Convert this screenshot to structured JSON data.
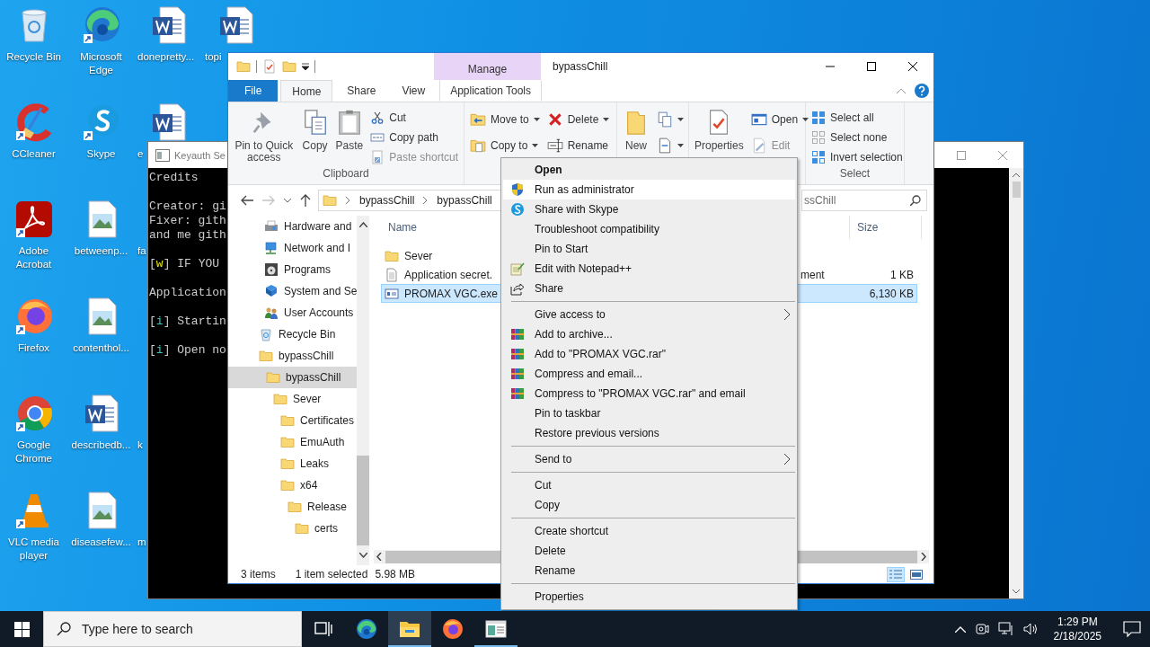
{
  "desktop": {
    "columns": [
      [
        {
          "kind": "bin",
          "label": "Recycle Bin"
        },
        {
          "kind": "cleaner",
          "label": "CCleaner"
        },
        {
          "kind": "acrobat",
          "label": "Adobe Acrobat"
        },
        {
          "kind": "firefox",
          "label": "Firefox"
        },
        {
          "kind": "chrome",
          "label": "Google Chrome"
        },
        {
          "kind": "vlc",
          "label": "VLC media player"
        }
      ],
      [
        {
          "kind": "edge",
          "label": "Microsoft Edge"
        },
        {
          "kind": "skype",
          "label": "Skype"
        },
        {
          "kind": "image",
          "label": "betweenp..."
        },
        {
          "kind": "image",
          "label": "contenthol..."
        },
        {
          "kind": "word",
          "label": "describedb..."
        },
        {
          "kind": "image",
          "label": "diseasefew..."
        }
      ],
      [
        {
          "kind": "word",
          "label": "donepretty..."
        },
        {
          "kind": "word",
          "label": "e"
        },
        {
          "kind": "hidden",
          "label": "fa"
        },
        {
          "kind": "hidden"
        },
        {
          "kind": "hidden",
          "label": "k"
        },
        {
          "kind": "hidden",
          "label": "m"
        }
      ],
      [
        {
          "kind": "word",
          "label": "topi"
        }
      ]
    ]
  },
  "console": {
    "title": "Keyauth Se",
    "paragraphs": [
      [
        [
          {
            "kind": "plain",
            "text": "Credits"
          }
        ]
      ],
      [
        [
          {
            "kind": "plain",
            "text": "Creator: gi"
          }
        ],
        [
          {
            "kind": "plain",
            "text": "Fixer: gith"
          }
        ],
        [
          {
            "kind": "plain",
            "text": "and me gith"
          }
        ]
      ],
      [
        [
          {
            "kind": "plain",
            "text": "["
          },
          {
            "kind": "warn",
            "text": "w"
          },
          {
            "kind": "plain",
            "text": "] IF YOU"
          }
        ]
      ],
      [
        [
          {
            "kind": "plain",
            "text": "Application"
          }
        ]
      ],
      [
        [
          {
            "kind": "plain",
            "text": "["
          },
          {
            "kind": "info",
            "text": "i"
          },
          {
            "kind": "plain",
            "text": "] Startin"
          }
        ]
      ],
      [
        [
          {
            "kind": "plain",
            "text": "["
          },
          {
            "kind": "info",
            "text": "i"
          },
          {
            "kind": "plain",
            "text": "] Open no"
          }
        ]
      ]
    ]
  },
  "explorer": {
    "title": "bypassChill",
    "context_tab": "Manage",
    "tabs": [
      {
        "kind": "file",
        "label": "File",
        "selected": false
      },
      {
        "kind": "tab",
        "label": "Home",
        "selected": true
      },
      {
        "kind": "tab",
        "label": "Share",
        "selected": false
      },
      {
        "kind": "tab",
        "label": "View",
        "selected": false
      },
      {
        "kind": "context",
        "label": "Application Tools",
        "selected": false
      }
    ],
    "ribbon": [
      {
        "label": "Clipboard",
        "columns": [
          {
            "kind": "large",
            "buttons": [
              {
                "label": "Pin to Quick access",
                "disabled": false
              }
            ]
          },
          {
            "kind": "large",
            "buttons": [
              {
                "label": "Copy",
                "disabled": false
              }
            ]
          },
          {
            "kind": "large",
            "buttons": [
              {
                "label": "Paste",
                "disabled": false
              }
            ]
          },
          {
            "kind": "stack",
            "buttons": [
              {
                "label": "Cut",
                "disabled": false
              },
              {
                "label": "Copy path",
                "disabled": false
              },
              {
                "label": "Paste shortcut",
                "disabled": true
              }
            ]
          }
        ]
      },
      {
        "columns": [
          {
            "kind": "pair",
            "buttons": [
              {
                "label": "Move to",
                "dropdown": true,
                "disabled": false
              },
              {
                "label": "Copy to",
                "dropdown": true,
                "disabled": false
              }
            ]
          },
          {
            "kind": "pair",
            "buttons": [
              {
                "label": "Delete",
                "dropdown": true,
                "disabled": false
              },
              {
                "label": "Rename",
                "dropdown": false,
                "disabled": false
              }
            ]
          }
        ]
      },
      {
        "columns": [
          {
            "kind": "large",
            "buttons": [
              {
                "label": "New",
                "disabled": false
              }
            ]
          },
          {
            "kind": "pair",
            "buttons": [
              {
                "dropdown": true
              },
              {
                "dropdown": true
              }
            ]
          }
        ]
      },
      {
        "columns": [
          {
            "kind": "large",
            "buttons": [
              {
                "label": "Properties",
                "disabled": false
              }
            ]
          },
          {
            "kind": "pair",
            "buttons": [
              {
                "label": "Open",
                "dropdown": true,
                "disabled": false
              },
              {
                "label": "Edit",
                "dropdown": false,
                "disabled": true
              }
            ]
          }
        ]
      },
      {
        "label": "Select",
        "columns": [
          {
            "kind": "stack",
            "buttons": [
              {
                "label": "Select all",
                "disabled": false
              },
              {
                "label": "Select none",
                "disabled": false
              },
              {
                "label": "Invert selection",
                "disabled": false
              }
            ]
          }
        ]
      }
    ],
    "address": {
      "crumbs": [
        "bypassChill",
        "bypassChill"
      ]
    },
    "search": {
      "placeholder": "ssChill"
    },
    "nav": [
      {
        "kind": "hardware",
        "label": "Hardware and",
        "selected": false
      },
      {
        "kind": "network",
        "label": "Network and I",
        "selected": false
      },
      {
        "kind": "programs",
        "label": "Programs",
        "selected": false
      },
      {
        "kind": "system",
        "label": "System and Se",
        "selected": false
      },
      {
        "kind": "users",
        "label": "User Accounts",
        "selected": false
      },
      {
        "kind": "bin",
        "label": "Recycle Bin",
        "selected": false
      },
      {
        "kind": "folder",
        "label": "bypassChill",
        "selected": false,
        "children": [
          {
            "kind": "folder",
            "label": "bypassChill",
            "selected": true,
            "children": [
              {
                "kind": "folder",
                "label": "Sever",
                "selected": false,
                "children": [
                  {
                    "kind": "folder",
                    "label": "Certificates",
                    "selected": false
                  },
                  {
                    "kind": "folder",
                    "label": "EmuAuth",
                    "selected": false
                  },
                  {
                    "kind": "folder",
                    "label": "Leaks",
                    "selected": false
                  },
                  {
                    "kind": "folder",
                    "label": "x64",
                    "selected": false,
                    "children": [
                      {
                        "kind": "folder",
                        "label": "Release",
                        "selected": false,
                        "children": [
                          {
                            "kind": "folder",
                            "label": "certs",
                            "selected": false
                          }
                        ]
                      }
                    ]
                  }
                ]
              }
            ]
          }
        ]
      }
    ],
    "columns": [
      "Name",
      "Size"
    ],
    "files": [
      {
        "kind": "folder",
        "name": "Sever",
        "selected": false
      },
      {
        "kind": "text",
        "name": "Application secret.",
        "type": "ment",
        "size": "1 KB",
        "selected": false
      },
      {
        "kind": "exe",
        "name": "PROMAX VGC.exe",
        "size": "6,130 KB",
        "selected": true
      }
    ],
    "status": {
      "count": "3 items",
      "selection": "1 item selected",
      "size": "5.98 MB"
    }
  },
  "context_menu": [
    {
      "kind": "default",
      "label": "Open",
      "highlighted": false
    },
    {
      "kind": "item",
      "label": "Run as administrator",
      "highlighted": true
    },
    {
      "kind": "item",
      "label": "Share with Skype",
      "highlighted": false
    },
    {
      "kind": "item",
      "label": "Troubleshoot compatibility",
      "highlighted": false
    },
    {
      "kind": "item",
      "label": "Pin to Start",
      "highlighted": false
    },
    {
      "kind": "item",
      "label": "Edit with Notepad++",
      "highlighted": false
    },
    {
      "kind": "item",
      "label": "Share",
      "highlighted": false
    },
    {
      "kind": "separator"
    },
    {
      "kind": "submenu",
      "label": "Give access to",
      "highlighted": false
    },
    {
      "kind": "item",
      "label": "Add to archive...",
      "highlighted": false
    },
    {
      "kind": "item",
      "label": "Add to \"PROMAX VGC.rar\"",
      "highlighted": false
    },
    {
      "kind": "item",
      "label": "Compress and email...",
      "highlighted": false
    },
    {
      "kind": "item",
      "label": "Compress to \"PROMAX VGC.rar\" and email",
      "highlighted": false
    },
    {
      "kind": "item",
      "label": "Pin to taskbar",
      "highlighted": false
    },
    {
      "kind": "item",
      "label": "Restore previous versions",
      "highlighted": false
    },
    {
      "kind": "separator"
    },
    {
      "kind": "submenu",
      "label": "Send to",
      "highlighted": false
    },
    {
      "kind": "separator"
    },
    {
      "kind": "item",
      "label": "Cut",
      "highlighted": false
    },
    {
      "kind": "item",
      "label": "Copy",
      "highlighted": false
    },
    {
      "kind": "separator"
    },
    {
      "kind": "item",
      "label": "Create shortcut",
      "highlighted": false
    },
    {
      "kind": "item",
      "label": "Delete",
      "highlighted": false
    },
    {
      "kind": "item",
      "label": "Rename",
      "highlighted": false
    },
    {
      "kind": "separator"
    },
    {
      "kind": "item",
      "label": "Properties",
      "highlighted": false
    }
  ],
  "taskbar": {
    "search": {
      "placeholder": "Type here to search"
    },
    "apps": [
      {
        "kind": "taskview",
        "active": false,
        "open": false
      },
      {
        "kind": "edge",
        "active": false,
        "open": false
      },
      {
        "kind": "explorer",
        "active": true,
        "open": true
      },
      {
        "kind": "firefox",
        "active": false,
        "open": false
      },
      {
        "kind": "console",
        "active": false,
        "open": true
      }
    ],
    "clock": {
      "time": "1:29 PM",
      "date": "2/18/2025"
    }
  }
}
